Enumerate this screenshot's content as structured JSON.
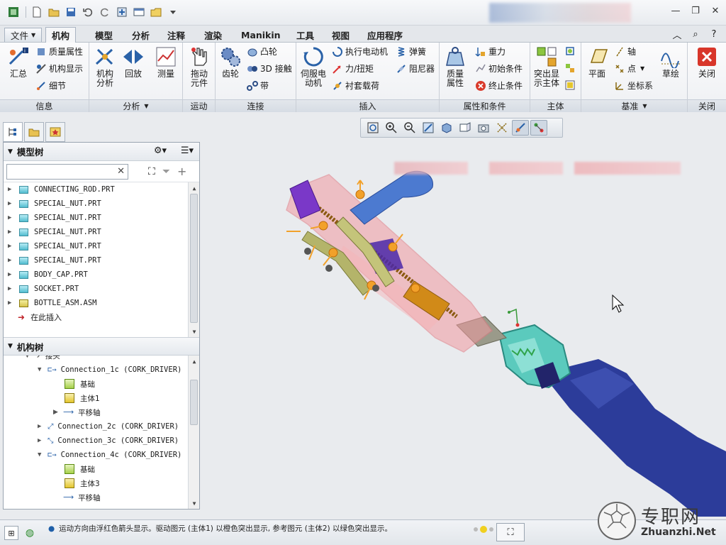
{
  "menu": {
    "file": "文件",
    "tabs": [
      "机构",
      "模型",
      "分析",
      "注释",
      "渲染",
      "Manikin",
      "工具",
      "视图",
      "应用程序"
    ],
    "active_tab": "机构"
  },
  "ribbon": {
    "info": {
      "label": "信息",
      "summary": "汇总",
      "mass_props": "质量属性",
      "mech_display": "机构显示",
      "detail": "细节"
    },
    "analysis": {
      "label": "分析",
      "mech_analysis": "机构\n分析",
      "playback": "回放",
      "measure": "测量"
    },
    "motion": {
      "label": "运动",
      "drag": "拖动\n元件"
    },
    "connect": {
      "label": "连接",
      "gear": "齿轮",
      "cam": "凸轮",
      "contact3d": "3D 接触",
      "belt": "带"
    },
    "insert": {
      "label": "插入",
      "servo": "伺服电\n动机",
      "exec_motor": "执行电动机",
      "force": "力/扭矩",
      "bushing": "衬套载荷",
      "spring": "弹簧",
      "damper": "阻尼器"
    },
    "props": {
      "label": "属性和条件",
      "mass": "质量\n属性",
      "gravity": "重力",
      "init_cond": "初始条件",
      "term_cond": "终止条件"
    },
    "body": {
      "label": "主体",
      "highlight": "突出显\n示主体"
    },
    "datum": {
      "label": "基准",
      "plane": "平面",
      "axis": "轴",
      "point": "点",
      "csys": "坐标系",
      "sketch": "草绘"
    },
    "close": {
      "label": "关闭",
      "close": "关闭"
    }
  },
  "model_tree": {
    "title": "模型树",
    "items": [
      "CONNECTING_ROD.PRT",
      "SPECIAL_NUT.PRT",
      "SPECIAL_NUT.PRT",
      "SPECIAL_NUT.PRT",
      "SPECIAL_NUT.PRT",
      "SPECIAL_NUT.PRT",
      "BODY_CAP.PRT",
      "SOCKET.PRT",
      "BOTTLE_ASM.ASM"
    ],
    "insert_here": "在此插入"
  },
  "mech_tree": {
    "title": "机构树",
    "partial_top": "接头",
    "rows": [
      {
        "level": 1,
        "label": "Connection_1c  (CORK_DRIVER)",
        "expanded": true
      },
      {
        "level": 2,
        "label": "基础"
      },
      {
        "level": 2,
        "label": "主体1"
      },
      {
        "level": 2,
        "label": "平移轴",
        "collapsed": true
      },
      {
        "level": 1,
        "label": "Connection_2c  (CORK_DRIVER)",
        "collapsed": true
      },
      {
        "level": 1,
        "label": "Connection_3c  (CORK_DRIVER)",
        "collapsed": true
      },
      {
        "level": 1,
        "label": "Connection_4c  (CORK_DRIVER)",
        "expanded": true
      },
      {
        "level": 2,
        "label": "基础"
      },
      {
        "level": 2,
        "label": "主体3"
      },
      {
        "level": 2,
        "label": "平移轴"
      }
    ]
  },
  "status": {
    "message": "运动方向由浮红色箭头显示。驱动图元 (主体1) 以橙色突出显示, 参考图元 (主体2) 以绿色突出显示。"
  },
  "watermark": {
    "cn": "专职网",
    "url": "Zhuanzhi.Net"
  },
  "colors": {
    "accent": "#1f5fa8",
    "ribbon_bg": "#f3f4f6",
    "bottle": "#2c3c9a",
    "shell": "#f19aa0"
  }
}
